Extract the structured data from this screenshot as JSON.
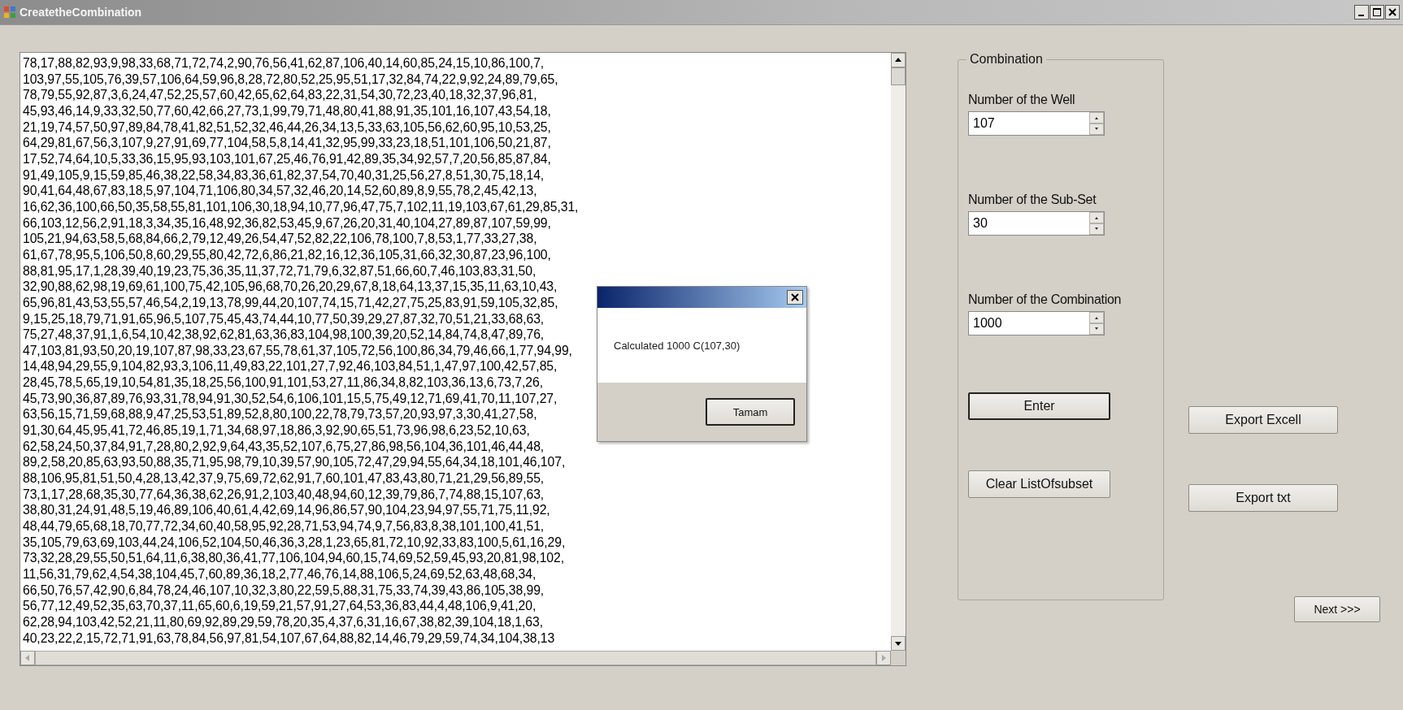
{
  "window": {
    "title": "CreatetheCombination"
  },
  "subsets": [
    "78,17,88,82,93,9,98,33,68,71,72,74,2,90,76,56,41,62,87,106,40,14,60,85,24,15,10,86,100,7,",
    "103,97,55,105,76,39,57,106,64,59,96,8,28,72,80,52,25,95,51,17,32,84,74,22,9,92,24,89,79,65,",
    "78,79,55,92,87,3,6,24,47,52,25,57,60,42,65,62,64,83,22,31,54,30,72,23,40,18,32,37,96,81,",
    "45,93,46,14,9,33,32,50,77,60,42,66,27,73,1,99,79,71,48,80,41,88,91,35,101,16,107,43,54,18,",
    "21,19,74,57,50,97,89,84,78,41,82,51,52,32,46,44,26,34,13,5,33,63,105,56,62,60,95,10,53,25,",
    "64,29,81,67,56,3,107,9,27,91,69,77,104,58,5,8,14,41,32,95,99,33,23,18,51,101,106,50,21,87,",
    "17,52,74,64,10,5,33,36,15,95,93,103,101,67,25,46,76,91,42,89,35,34,92,57,7,20,56,85,87,84,",
    "91,49,105,9,15,59,85,46,38,22,58,34,83,36,61,82,37,54,70,40,31,25,56,27,8,51,30,75,18,14,",
    "90,41,64,48,67,83,18,5,97,104,71,106,80,34,57,32,46,20,14,52,60,89,8,9,55,78,2,45,42,13,",
    "16,62,36,100,66,50,35,58,55,81,101,106,30,18,94,10,77,96,47,75,7,102,11,19,103,67,61,29,85,31,",
    "66,103,12,56,2,91,18,3,34,35,16,48,92,36,82,53,45,9,67,26,20,31,40,104,27,89,87,107,59,99,",
    "105,21,94,63,58,5,68,84,66,2,79,12,49,26,54,47,52,82,22,106,78,100,7,8,53,1,77,33,27,38,",
    "61,67,78,95,5,106,50,8,60,29,55,80,42,72,6,86,21,82,16,12,36,105,31,66,32,30,87,23,96,100,",
    "88,81,95,17,1,28,39,40,19,23,75,36,35,11,37,72,71,79,6,32,87,51,66,60,7,46,103,83,31,50,",
    "32,90,88,62,98,19,69,61,100,75,42,105,96,68,70,26,20,29,67,8,18,64,13,37,15,35,11,63,10,43,",
    "65,96,81,43,53,55,57,46,54,2,19,13,78,99,44,20,107,74,15,71,42,27,75,25,83,91,59,105,32,85,",
    "9,15,25,18,79,71,91,65,96,5,107,75,45,43,74,44,10,77,50,39,29,27,87,32,70,51,21,33,68,63,",
    "75,27,48,37,91,1,6,54,10,42,38,92,62,81,63,36,83,104,98,100,39,20,52,14,84,74,8,47,89,76,",
    "47,103,81,93,50,20,19,107,87,98,33,23,67,55,78,61,37,105,72,56,100,86,34,79,46,66,1,77,94,99,",
    "14,48,94,29,55,9,104,82,93,3,106,11,49,83,22,101,27,7,92,46,103,84,51,1,47,97,100,42,57,85,",
    "28,45,78,5,65,19,10,54,81,35,18,25,56,100,91,101,53,27,11,86,34,8,82,103,36,13,6,73,7,26,",
    "45,73,90,36,87,89,76,93,31,78,94,91,30,52,54,6,106,101,15,5,75,49,12,71,69,41,70,11,107,27,",
    "63,56,15,71,59,68,88,9,47,25,53,51,89,52,8,80,100,22,78,79,73,57,20,93,97,3,30,41,27,58,",
    "91,30,64,45,95,41,72,46,85,19,1,71,34,68,97,18,86,3,92,90,65,51,73,96,98,6,23,52,10,63,",
    "62,58,24,50,37,84,91,7,28,80,2,92,9,64,43,35,52,107,6,75,27,86,98,56,104,36,101,46,44,48,",
    "89,2,58,20,85,63,93,50,88,35,71,95,98,79,10,39,57,90,105,72,47,29,94,55,64,34,18,101,46,107,",
    "88,106,95,81,51,50,4,28,13,42,37,9,75,69,72,62,91,7,60,101,47,83,43,80,71,21,29,56,89,55,",
    "73,1,17,28,68,35,30,77,64,36,38,62,26,91,2,103,40,48,94,60,12,39,79,86,7,74,88,15,107,63,",
    "38,80,31,24,91,48,5,19,46,89,106,40,61,4,42,69,14,96,86,57,90,104,23,94,97,55,71,75,11,92,",
    "48,44,79,65,68,18,70,77,72,34,60,40,58,95,92,28,71,53,94,74,9,7,56,83,8,38,101,100,41,51,",
    "35,105,79,63,69,103,44,24,106,52,104,50,46,36,3,28,1,23,65,81,72,10,92,33,83,100,5,61,16,29,",
    "73,32,28,29,55,50,51,64,11,6,38,80,36,41,77,106,104,94,60,15,74,69,52,59,45,93,20,81,98,102,",
    "11,56,31,79,62,4,54,38,104,45,7,60,89,36,18,2,77,46,76,14,88,106,5,24,69,52,63,48,68,34,",
    "66,50,76,57,42,90,6,84,78,24,46,107,10,32,3,80,22,59,5,88,31,75,33,74,39,43,86,105,38,99,",
    "56,77,12,49,52,35,63,70,37,11,65,60,6,19,59,21,57,91,27,64,53,36,83,44,4,48,106,9,41,20,",
    "62,28,94,103,42,52,21,11,80,69,92,89,29,59,78,20,35,4,37,6,31,16,67,38,82,39,104,18,1,63,",
    "40,23,22,2,15,72,71,91,63,78,84,56,97,81,54,107,67,64,88,82,14,46,79,29,59,74,34,104,38,13"
  ],
  "group": {
    "title": "Combination",
    "fields": [
      {
        "label": "Number of the Well",
        "value": "107"
      },
      {
        "label": "Number of the Sub-Set",
        "value": "30"
      },
      {
        "label": "Number of the Combination",
        "value": "1000"
      }
    ],
    "buttons": [
      {
        "label": "Enter",
        "default": true
      },
      {
        "label": "Clear ListOfsubset",
        "default": false
      }
    ]
  },
  "export_buttons": [
    {
      "label": "Export Excell",
      "default": false
    },
    {
      "label": "Export txt",
      "default": false
    }
  ],
  "next_button": {
    "label": "Next >>>"
  },
  "dialog": {
    "message": "Calculated 1000 C(107,30)",
    "button": {
      "label": "Tamam",
      "default": true
    }
  }
}
